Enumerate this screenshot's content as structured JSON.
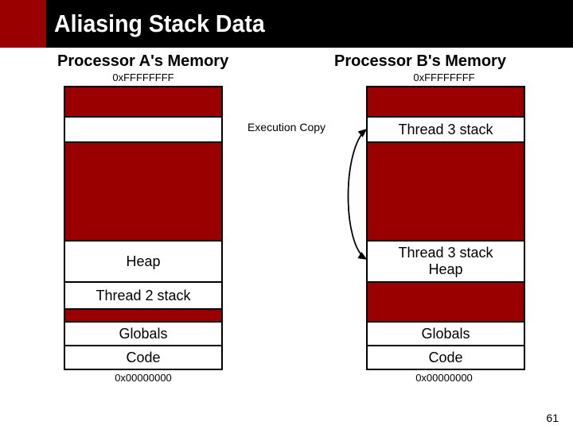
{
  "title": "Aliasing Stack Data",
  "procA": {
    "header": "Processor A's Memory",
    "top_addr": "0xFFFFFFFF",
    "bottom_addr": "0x00000000",
    "segments": {
      "heap": "Heap",
      "t2stack": "Thread 2 stack",
      "globals": "Globals",
      "code": "Code"
    }
  },
  "procB": {
    "header": "Processor B's Memory",
    "top_addr": "0xFFFFFFFF",
    "bottom_addr": "0x00000000",
    "segments": {
      "t3stack": "Thread 3 stack",
      "t3heap_line1": "Thread 3 stack",
      "t3heap_line2": "Heap",
      "globals": "Globals",
      "code": "Code"
    }
  },
  "exec_copy": "Execution Copy",
  "page_number": "61"
}
